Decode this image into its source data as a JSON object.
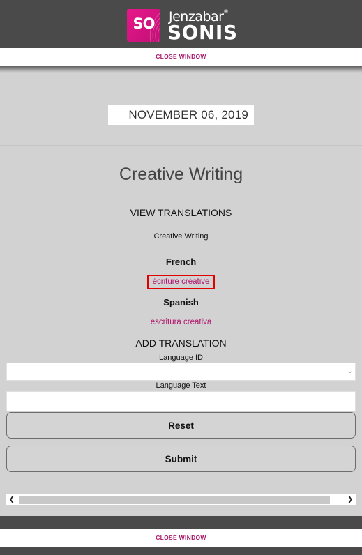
{
  "header": {
    "logo_initials": "SO",
    "brand_name": "Jenzabar",
    "trademark": "®",
    "product_name": "SONIS"
  },
  "close_window_label": "CLOSE WINDOW",
  "date": "NOVEMBER 06, 2019",
  "course_title": "Creative Writing",
  "view_translations_heading": "VIEW TRANSLATIONS",
  "course_name": "Creative Writing",
  "translations": [
    {
      "language": "French",
      "text": "écriture créative"
    },
    {
      "language": "Spanish",
      "text": "escritura creativa"
    }
  ],
  "add_translation": {
    "heading": "ADD TRANSLATION",
    "language_id_label": "Language ID",
    "language_id_value": "",
    "language_text_label": "Language Text",
    "language_text_value": ""
  },
  "buttons": {
    "reset": "Reset",
    "submit": "Submit"
  },
  "icons": {
    "select_chevron": "chevron-down-icon",
    "scroll_left": "chevron-left-icon",
    "scroll_right": "chevron-right-icon"
  },
  "colors": {
    "brand_magenta": "#e8178a",
    "link_color": "#b0166f",
    "highlight_border": "#e00000",
    "header_bg": "#4a4a4a",
    "content_bg": "#d2d2d2"
  }
}
